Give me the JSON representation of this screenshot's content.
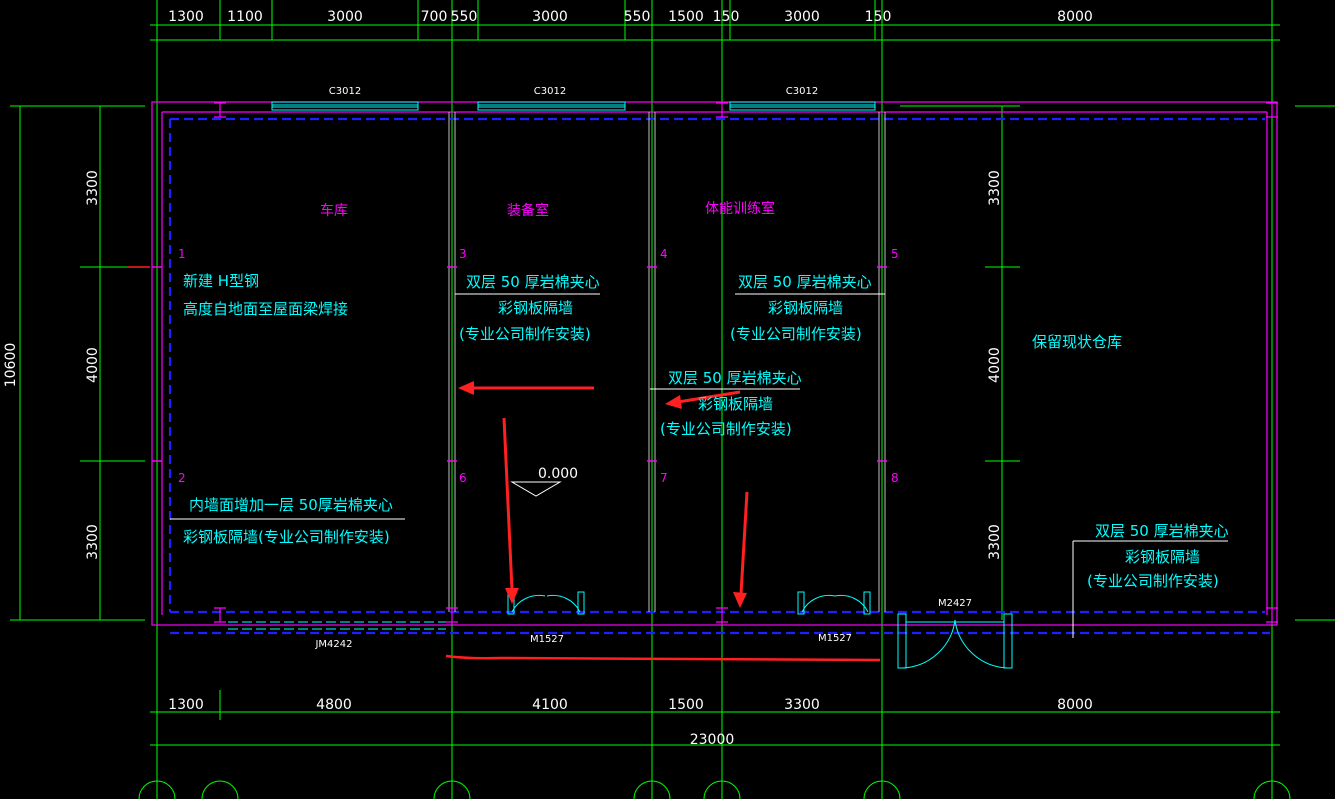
{
  "top_dims": [
    "1300",
    "1100",
    "3000",
    "700",
    "550",
    "3000",
    "550",
    "1500",
    "150",
    "3000",
    "150",
    "8000"
  ],
  "bottom_dims": [
    "1300",
    "4800",
    "4100",
    "1500",
    "3300",
    "8000"
  ],
  "total_dim": "23000",
  "left_dims": [
    "3300",
    "4000",
    "3300"
  ],
  "left_total": "10600",
  "right_dims": [
    "3300",
    "4000",
    "3300"
  ],
  "windows": [
    "C3012",
    "C3012",
    "C3012"
  ],
  "doors": [
    "JM4242",
    "M1527",
    "M1527",
    "M2427"
  ],
  "rooms": [
    "车库",
    "装备室",
    "体能训练室",
    "保留现状仓库"
  ],
  "column_numbers": [
    "1",
    "2",
    "3",
    "4",
    "5",
    "6",
    "7",
    "8"
  ],
  "elevation": "0.000",
  "notes": {
    "steel": [
      "新建 H型钢",
      "高度自地面至屋面梁焊接"
    ],
    "wall_a": [
      "双层 50 厚岩棉夹心",
      "彩钢板隔墙",
      "(专业公司制作安装)"
    ],
    "wall_b": [
      "双层 50 厚岩棉夹心",
      "彩钢板隔墙",
      "(专业公司制作安装)"
    ],
    "wall_c": [
      "双层 50 厚岩棉夹心",
      "彩钢板隔墙",
      "(专业公司制作安装)"
    ],
    "wall_d": [
      "双层 50 厚岩棉夹心",
      "彩钢板隔墙",
      "(专业公司制作安装)"
    ],
    "inner_wall": [
      "内墙面增加一层   50厚岩棉夹心",
      "彩钢板隔墙(专业公司制作安装)"
    ]
  },
  "colors": {
    "background": "#000000",
    "grid": "#00ff00",
    "wall": "#ff00ff",
    "dashed": "#0000ff",
    "text": "#ffffff",
    "note": "#00ffff",
    "markup": "#ff2020"
  }
}
